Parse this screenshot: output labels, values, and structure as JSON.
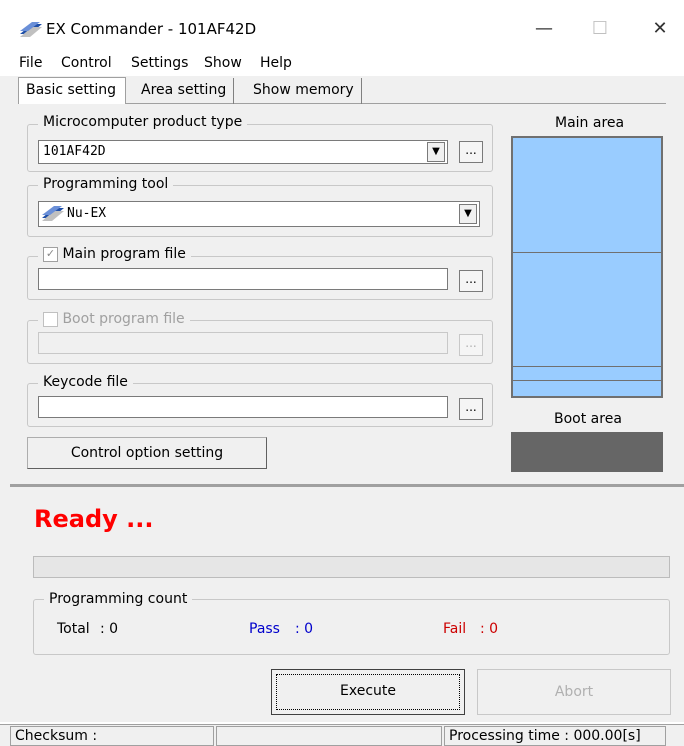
{
  "window": {
    "title": "EX Commander - 101AF42D",
    "minimize_label": "—",
    "maximize_label": "☐",
    "close_label": "✕"
  },
  "menu": [
    "File",
    "Control",
    "Settings",
    "Show",
    "Help"
  ],
  "tabs": [
    "Basic setting",
    "Area setting",
    "Show memory"
  ],
  "micro": {
    "label": "Microcomputer product type",
    "value": "101AF42D",
    "browse": "..."
  },
  "tool": {
    "label": "Programming tool",
    "value": "Nu-EX"
  },
  "main_file": {
    "label": "Main program file",
    "value": "",
    "browse": "...",
    "checked": true
  },
  "boot_file": {
    "label": "Boot program file",
    "value": "",
    "browse": "...",
    "checked": false
  },
  "keycode": {
    "label": "Keycode file",
    "value": "",
    "browse": "..."
  },
  "control_option_button": "Control option setting",
  "memory": {
    "main_area_label": "Main area",
    "boot_area_label": "Boot area",
    "main_color": "#99ccff",
    "boot_color": "#666666"
  },
  "status": {
    "text": "Ready ...",
    "color": "#ff0000",
    "progress": 0
  },
  "count": {
    "label": "Programming count",
    "total_label": "Total",
    "total_value": ": 0",
    "pass_label": "Pass",
    "pass_value": ": 0",
    "fail_label": "Fail",
    "fail_value": ": 0",
    "pass_color": "#0000cc",
    "fail_color": "#cc0000"
  },
  "actions": {
    "execute": "Execute",
    "abort": "Abort"
  },
  "statusbar": {
    "checksum_label": "Checksum :",
    "middle": "",
    "processing_time": "Processing time :  000.00[s]"
  }
}
